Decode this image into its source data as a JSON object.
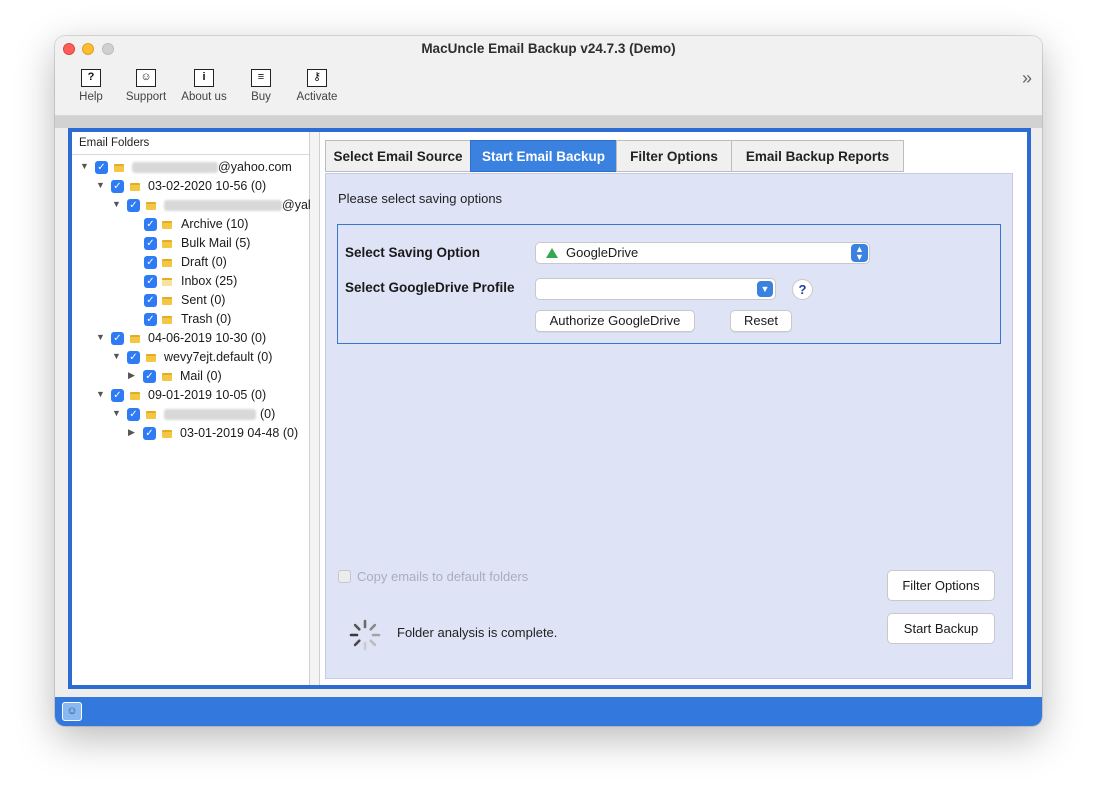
{
  "window": {
    "title": "MacUncle Email Backup v24.7.3 (Demo)"
  },
  "toolbar": [
    {
      "label": "Help",
      "icon": "help-icon",
      "glyph": "?"
    },
    {
      "label": "Support",
      "icon": "support-icon",
      "glyph": "☺"
    },
    {
      "label": "About us",
      "icon": "info-icon",
      "glyph": "i"
    },
    {
      "label": "Buy",
      "icon": "cart-icon",
      "glyph": "≡"
    },
    {
      "label": "Activate",
      "icon": "key-icon",
      "glyph": "⚷"
    }
  ],
  "more_icon": "»",
  "left": {
    "header": "Email Folders",
    "tree": [
      {
        "label": "@yahoo.com",
        "blur_prefix": true
      },
      {
        "label": "03-02-2020 10-56 (0)"
      },
      {
        "label": "@yal",
        "blur_prefix": true
      },
      {
        "label": "Archive (10)"
      },
      {
        "label": "Bulk Mail (5)"
      },
      {
        "label": "Draft (0)"
      },
      {
        "label": "Inbox (25)"
      },
      {
        "label": "Sent (0)"
      },
      {
        "label": "Trash (0)"
      },
      {
        "label": "04-06-2019 10-30 (0)"
      },
      {
        "label": "wevy7ejt.default (0)"
      },
      {
        "label": "Mail (0)"
      },
      {
        "label": "09-01-2019 10-05 (0)"
      },
      {
        "label": "(0)",
        "blur_prefix": true
      },
      {
        "label": "03-01-2019 04-48 (0)"
      }
    ]
  },
  "tabs": [
    "Select Email Source",
    "Start Email Backup",
    "Filter Options",
    "Email Backup Reports"
  ],
  "active_tab": "Start Email Backup",
  "main": {
    "prompt": "Please select saving options",
    "saving_option_label": "Select Saving Option",
    "saving_option_value": "GoogleDrive",
    "profile_label": "Select GoogleDrive Profile",
    "profile_value": "",
    "help_glyph": "?",
    "authorize_button": "Authorize GoogleDrive",
    "reset_button": "Reset",
    "copy_checkbox_label": "Copy emails to default folders",
    "filter_button": "Filter Options",
    "start_button": "Start Backup",
    "status_text": "Folder analysis is complete."
  },
  "colors": {
    "accent": "#3b82e0",
    "content_bg": "#dfe3f6",
    "frame": "#2d6bd3",
    "checkbox": "#2f7bf5"
  }
}
